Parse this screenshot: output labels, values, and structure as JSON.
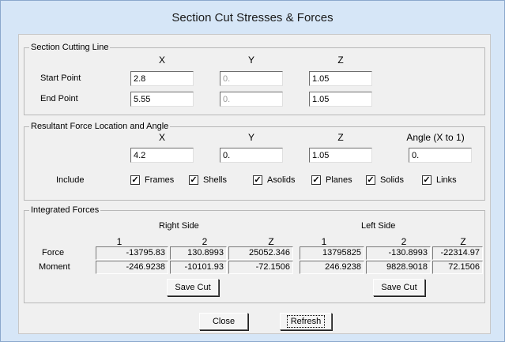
{
  "title": "Section Cut Stresses & Forces",
  "section_cutting_line": {
    "legend": "Section Cutting Line",
    "headers": [
      "X",
      "Y",
      "Z"
    ],
    "start": {
      "label": "Start Point",
      "x": "2.8",
      "y": "0.",
      "z": "1.05"
    },
    "end": {
      "label": "End Point",
      "x": "5.55",
      "y": "0.",
      "z": "1.05"
    }
  },
  "resultant": {
    "legend": "Resultant Force Location and Angle",
    "headers": [
      "X",
      "Y",
      "Z",
      "Angle (X to 1)"
    ],
    "x": "4.2",
    "y": "0.",
    "z": "1.05",
    "angle": "0.",
    "include_label": "Include",
    "checks": [
      {
        "label": "Frames",
        "checked": true
      },
      {
        "label": "Shells",
        "checked": true
      },
      {
        "label": "Asolids",
        "checked": true
      },
      {
        "label": "Planes",
        "checked": true
      },
      {
        "label": "Solids",
        "checked": true
      },
      {
        "label": "Links",
        "checked": true
      }
    ]
  },
  "integrated": {
    "legend": "Integrated Forces",
    "right_label": "Right Side",
    "left_label": "Left Side",
    "col_headers": [
      "1",
      "2",
      "Z"
    ],
    "force_label": "Force",
    "moment_label": "Moment",
    "right_force": [
      "-13795.83",
      "130.8993",
      "25052.346"
    ],
    "right_moment": [
      "-246.9238",
      "-10101.93",
      "-72.1506"
    ],
    "left_force": [
      "13795825",
      "-130.8993",
      "-22314.97"
    ],
    "left_moment": [
      "246.9238",
      "9828.9018",
      "72.1506"
    ],
    "save_label": "Save Cut"
  },
  "buttons": {
    "close": "Close",
    "refresh": "Refresh"
  }
}
